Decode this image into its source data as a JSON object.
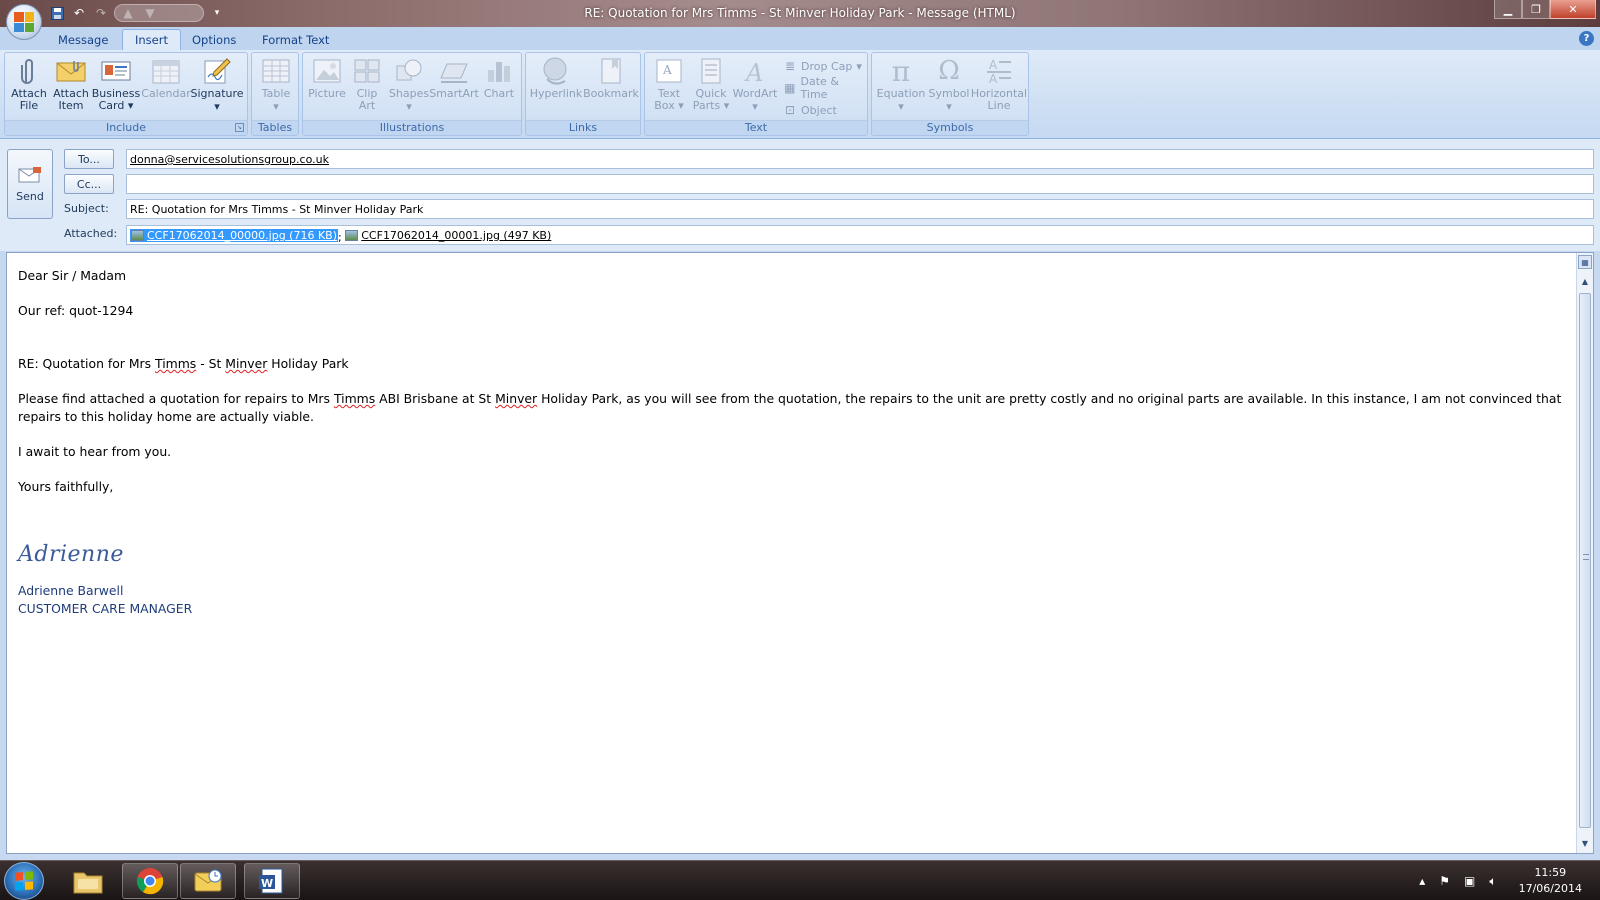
{
  "window": {
    "title": "RE: Quotation for Mrs Timms - St Minver Holiday Park  -  Message (HTML)"
  },
  "ribbon_tabs": [
    "Message",
    "Insert",
    "Options",
    "Format Text"
  ],
  "active_tab": "Insert",
  "ribbon": {
    "include": {
      "label": "Include",
      "attach_file": "Attach\nFile",
      "attach_item": "Attach\nItem",
      "business_card": "Business\nCard",
      "calendar": "Calendar",
      "signature": "Signature"
    },
    "tables": {
      "label": "Tables",
      "table": "Table"
    },
    "illustrations": {
      "label": "Illustrations",
      "picture": "Picture",
      "clip_art": "Clip\nArt",
      "shapes": "Shapes",
      "smartart": "SmartArt",
      "chart": "Chart"
    },
    "links": {
      "label": "Links",
      "hyperlink": "Hyperlink",
      "bookmark": "Bookmark"
    },
    "text": {
      "label": "Text",
      "text_box": "Text\nBox",
      "quick_parts": "Quick\nParts",
      "wordart": "WordArt",
      "drop_cap": "Drop Cap",
      "date_time": "Date & Time",
      "object": "Object"
    },
    "symbols": {
      "label": "Symbols",
      "equation": "Equation",
      "symbol": "Symbol",
      "horizontal_line": "Horizontal\nLine"
    }
  },
  "compose": {
    "send_label": "Send",
    "to_button": "To...",
    "cc_button": "Cc...",
    "subject_label": "Subject:",
    "attached_label": "Attached:",
    "to_value": "donna@servicesolutionsgroup.co.uk",
    "cc_value": "",
    "subject_value": "RE: Quotation for Mrs Timms - St Minver Holiday Park",
    "attachments": [
      {
        "name": "CCF17062014_00000.jpg (716 KB)",
        "selected": true
      },
      {
        "name": "CCF17062014_00001.jpg (497 KB)",
        "selected": false
      }
    ],
    "attachment_sep": ";"
  },
  "body": {
    "greeting": "Dear Sir / Madam",
    "ref": "Our ref: quot-1294",
    "re_pre": "RE: Quotation for Mrs ",
    "re_timms": "Timms",
    "re_mid": " - St ",
    "re_minver": "Minver",
    "re_post": " Holiday Park",
    "para_pre": "Please find attached a quotation for repairs to Mrs ",
    "para_timms": "Timms",
    "para_mid": " ABI Brisbane at St ",
    "para_minver": "Minver",
    "para_post": " Holiday Park, as you will see from the quotation, the repairs to the unit are pretty costly and no original parts are available.  In this instance, I  am not convinced that repairs to this holiday home are actually viable.",
    "await": "I await to hear from you.",
    "closing": "Yours faithfully,",
    "signature_script": "Adrienne",
    "sig_name": "Adrienne Barwell",
    "sig_title": "CUSTOMER CARE MANAGER"
  },
  "taskbar": {
    "time": "11:59",
    "date": "17/06/2014"
  }
}
